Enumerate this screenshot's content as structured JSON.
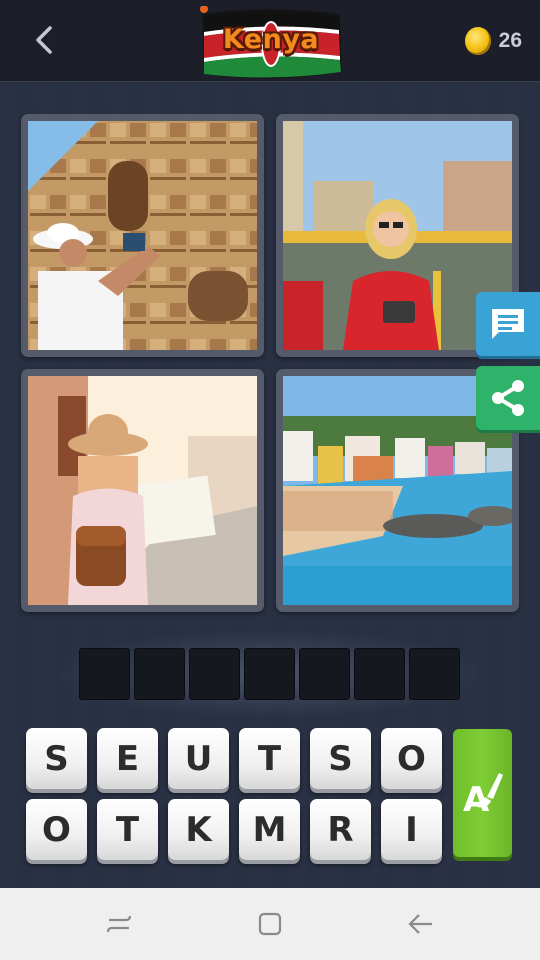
{
  "header": {
    "back_icon": "chevron-left-icon",
    "level_title": "Kenya",
    "coins": "26",
    "colors": {
      "bar": "#1c1f29",
      "coin": "#f5c518",
      "title": "#f28a1e"
    }
  },
  "photos": [
    {
      "id": "photo-1",
      "subject": "tourist photographing building"
    },
    {
      "id": "photo-2",
      "subject": "smiling woman with camera"
    },
    {
      "id": "photo-3",
      "subject": "woman with map and backpack"
    },
    {
      "id": "photo-4",
      "subject": "crowded beach town"
    }
  ],
  "side_buttons": [
    {
      "icon": "chat-icon",
      "color": "#3aa3d6"
    },
    {
      "icon": "share-icon",
      "color": "#2fb36a"
    }
  ],
  "answer_slots": 7,
  "letters": {
    "row1": [
      "S",
      "E",
      "U",
      "T",
      "S",
      "O"
    ],
    "row2": [
      "O",
      "T",
      "K",
      "M",
      "R",
      "I"
    ]
  },
  "hint_button": {
    "label": "A",
    "icon": "brush-icon",
    "color": "#7fcd34"
  },
  "navbar": {
    "items": [
      "recent-apps-icon",
      "home-icon",
      "back-arrow-icon"
    ]
  }
}
